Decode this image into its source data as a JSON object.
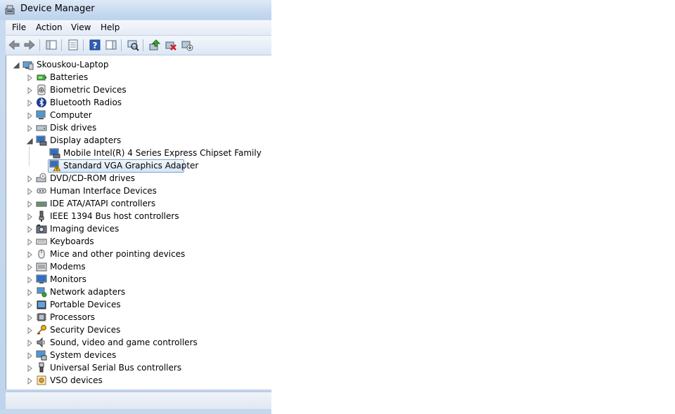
{
  "window": {
    "title": "Device Manager"
  },
  "menu": [
    "File",
    "Action",
    "View",
    "Help"
  ],
  "toolbar": [
    "back",
    "forward",
    "show-hide-console-tree",
    "properties",
    "help",
    "action-pane",
    "scan-hardware",
    "update-driver",
    "uninstall",
    "disable"
  ],
  "tree": {
    "root": "Skouskou-Laptop",
    "categories": [
      {
        "label": "Batteries",
        "icon": "battery-icon"
      },
      {
        "label": "Biometric Devices",
        "icon": "fingerprint-icon"
      },
      {
        "label": "Bluetooth Radios",
        "icon": "bluetooth-icon"
      },
      {
        "label": "Computer",
        "icon": "computer-icon"
      },
      {
        "label": "Disk drives",
        "icon": "disk-drive-icon"
      },
      {
        "label": "Display adapters",
        "icon": "display-adapter-icon",
        "expanded": true,
        "children": [
          {
            "label": "Mobile Intel(R) 4 Series Express Chipset Family",
            "icon": "display-adapter-icon"
          },
          {
            "label": "Standard VGA Graphics Adapter",
            "icon": "display-adapter-warning-icon",
            "selected": true
          }
        ]
      },
      {
        "label": "DVD/CD-ROM drives",
        "icon": "dvd-drive-icon"
      },
      {
        "label": "Human Interface Devices",
        "icon": "hid-icon"
      },
      {
        "label": "IDE ATA/ATAPI controllers",
        "icon": "ide-controller-icon"
      },
      {
        "label": "IEEE 1394 Bus host controllers",
        "icon": "firewire-icon"
      },
      {
        "label": "Imaging devices",
        "icon": "camera-icon"
      },
      {
        "label": "Keyboards",
        "icon": "keyboard-icon"
      },
      {
        "label": "Mice and other pointing devices",
        "icon": "mouse-icon"
      },
      {
        "label": "Modems",
        "icon": "modem-icon"
      },
      {
        "label": "Monitors",
        "icon": "monitor-icon"
      },
      {
        "label": "Network adapters",
        "icon": "network-adapter-icon"
      },
      {
        "label": "Portable Devices",
        "icon": "portable-device-icon"
      },
      {
        "label": "Processors",
        "icon": "processor-icon"
      },
      {
        "label": "Security Devices",
        "icon": "security-key-icon"
      },
      {
        "label": "Sound, video and game controllers",
        "icon": "speaker-icon"
      },
      {
        "label": "System devices",
        "icon": "system-device-icon"
      },
      {
        "label": "Universal Serial Bus controllers",
        "icon": "usb-icon"
      },
      {
        "label": "VSO devices",
        "icon": "vso-device-icon"
      }
    ]
  },
  "colors": {
    "selection": "#d6e6f7",
    "selection_border": "#7da2ce",
    "warning": "#f5c400"
  }
}
